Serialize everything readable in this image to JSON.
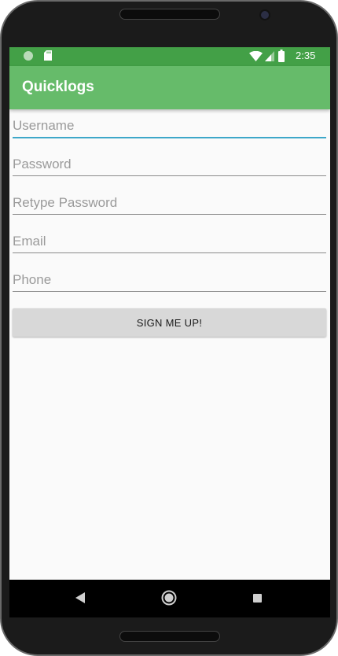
{
  "status_bar": {
    "time": "2:35",
    "icons": [
      "notification-circle-icon",
      "sd-card-icon",
      "wifi-icon",
      "signal-icon",
      "battery-icon"
    ]
  },
  "app_bar": {
    "title": "Quicklogs"
  },
  "form": {
    "username": {
      "placeholder": "Username",
      "value": ""
    },
    "password": {
      "placeholder": "Password",
      "value": ""
    },
    "retype_password": {
      "placeholder": "Retype Password",
      "value": ""
    },
    "email": {
      "placeholder": "Email",
      "value": ""
    },
    "phone": {
      "placeholder": "Phone",
      "value": ""
    },
    "submit_label": "SIGN ME UP!"
  },
  "nav_bar": {
    "icons": [
      "back-icon",
      "home-icon",
      "recent-apps-icon"
    ]
  },
  "colors": {
    "status_bar": "#43a047",
    "app_bar": "#66bb6a",
    "focus_underline": "#3da7c9",
    "button_bg": "#d8d8d8"
  }
}
